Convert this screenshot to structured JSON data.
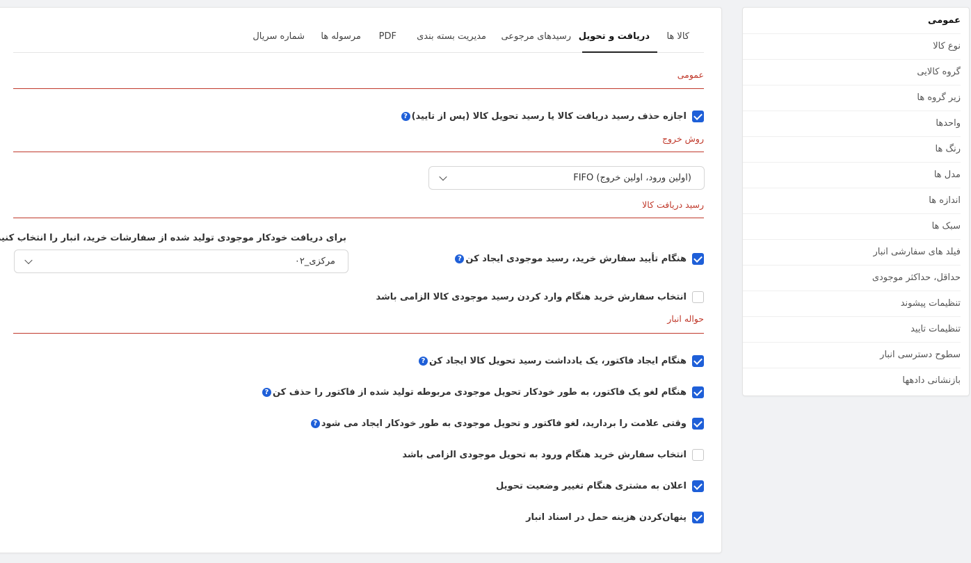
{
  "sidebar": {
    "items": [
      {
        "label": "عمومی",
        "active": true
      },
      {
        "label": "نوع کالا"
      },
      {
        "label": "گروه کالایی"
      },
      {
        "label": "زیر گروه ها"
      },
      {
        "label": "واحدها"
      },
      {
        "label": "رنگ ها"
      },
      {
        "label": "مدل ها"
      },
      {
        "label": "اندازه ها"
      },
      {
        "label": "سبک ها"
      },
      {
        "label": "فیلد های سفارشی انبار"
      },
      {
        "label": "حداقل، حداکثر موجودی"
      },
      {
        "label": "تنظیمات پیشوند"
      },
      {
        "label": "تنظیمات تایید"
      },
      {
        "label": "سطوح دسترسی انبار"
      },
      {
        "label": "بازنشانی دادهها"
      }
    ]
  },
  "tabs": [
    {
      "label": "کالا ها"
    },
    {
      "label": "دریافت و تحویل",
      "active": true
    },
    {
      "label": "رسیدهای مرجوعی"
    },
    {
      "label": "مدیریت بسته بندی"
    },
    {
      "label": "PDF"
    },
    {
      "label": "مرسوله ها"
    },
    {
      "label": "شماره سریال"
    }
  ],
  "sections": {
    "general": {
      "title": "عمومی",
      "allow_delete": {
        "label": "اجازه حذف رسید دریافت کالا یا رسید تحویل کالا (پس از تایید)",
        "checked": true
      }
    },
    "exit_method": {
      "title": "روش خروج",
      "select_value": "FIFO (اولین ورود، اولین خروج)"
    },
    "goods_receipt": {
      "title": "رسید دریافت کالا",
      "auto_receipt": {
        "label": "هنگام تأیید سفارش خرید، رسید موجودی ایجاد کن",
        "checked": true
      },
      "require_po": {
        "label": "انتخاب سفارش خرید هنگام وارد کردن رسید موجودی کالا الزامی باشد",
        "checked": false
      },
      "warehouse_label": "برای دریافت خودکار موجودی تولید شده از سفارشات خرید، انبار را انتخاب کنید",
      "warehouse_value": "۰۲_مرکزی"
    },
    "warehouse_transfer": {
      "title": "حواله انبار",
      "items": [
        {
          "label": "هنگام ایجاد فاکتور، یک یادداشت رسید تحویل کالا ایجاد کن",
          "checked": true,
          "help": true
        },
        {
          "label": "هنگام لغو یک فاکتور، به طور خودکار تحویل موجودی مربوطه تولید شده از فاکتور را حذف کن",
          "checked": true,
          "help": true
        },
        {
          "label": "وقتی علامت را بردارید، لغو فاکتور و تحویل موجودی به طور خودکار ایجاد می شود",
          "checked": true,
          "help": true
        },
        {
          "label": "انتخاب سفارش خرید هنگام ورود به تحویل موجودی الزامی باشد",
          "checked": false,
          "help": false
        },
        {
          "label": "اعلان به مشتری هنگام تغییر وضعیت تحویل",
          "checked": true,
          "help": false
        },
        {
          "label": "پنهان‌کردن هزینه حمل در اسناد انبار",
          "checked": true,
          "help": false
        }
      ]
    }
  },
  "help_glyph": "?",
  "colors": {
    "accent": "#1e5fd8",
    "section": "#c0392b"
  }
}
